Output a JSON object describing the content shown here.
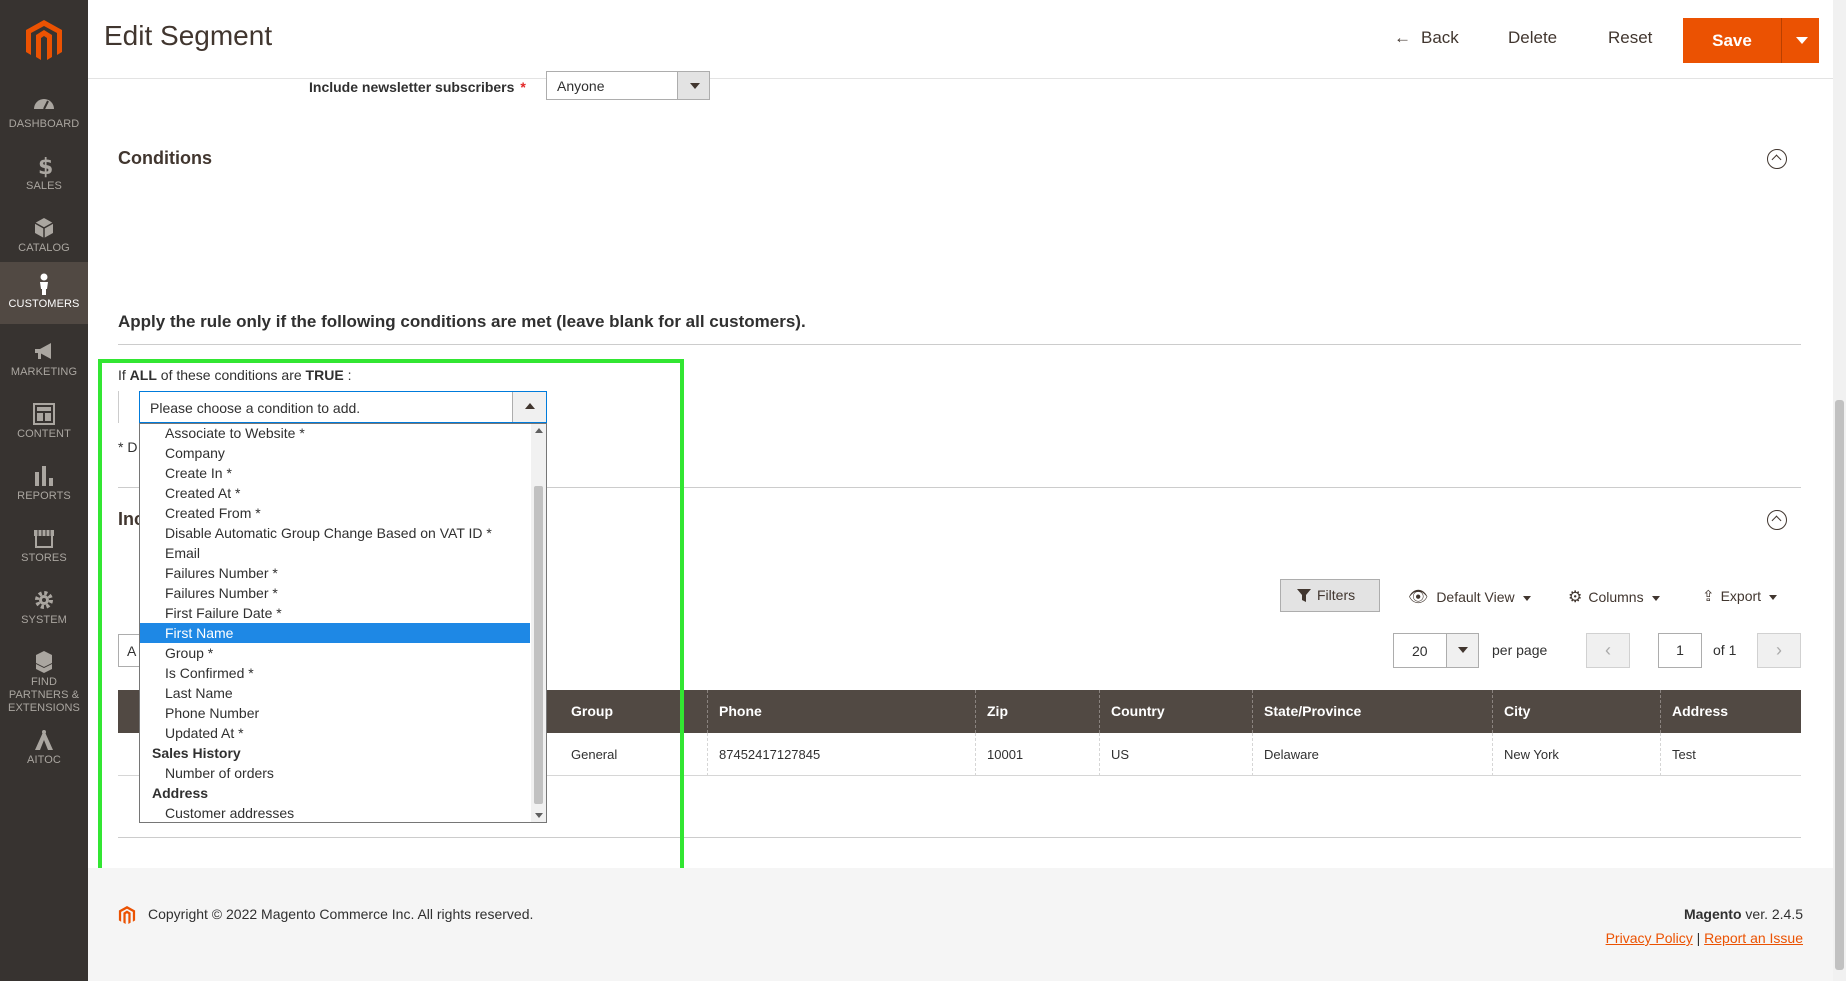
{
  "sidebar": {
    "items": [
      {
        "label": "DASHBOARD"
      },
      {
        "label": "SALES"
      },
      {
        "label": "CATALOG"
      },
      {
        "label": "CUSTOMERS"
      },
      {
        "label": "MARKETING"
      },
      {
        "label": "CONTENT"
      },
      {
        "label": "REPORTS"
      },
      {
        "label": "STORES"
      },
      {
        "label": "SYSTEM"
      },
      {
        "label": "FIND PARTNERS & EXTENSIONS"
      },
      {
        "label": "AITOC"
      }
    ],
    "active": "CUSTOMERS"
  },
  "header": {
    "title": "Edit Segment",
    "back_label": "Back",
    "delete_label": "Delete",
    "reset_label": "Reset",
    "save_label": "Save"
  },
  "form": {
    "newsletter_label": "Include newsletter subscribers",
    "newsletter_value": "Anyone",
    "required_mark": "*"
  },
  "conditions": {
    "section_title": "Conditions",
    "rule_heading": "Apply the rule only if the following conditions are met (leave blank for all customers).",
    "if_text": "If",
    "all_text": "ALL",
    "of_these_text": "of these conditions are",
    "true_text": "TRUE",
    "colon": ":",
    "select_placeholder": "Please choose a condition to add.",
    "note_fragment": "* D",
    "options": [
      {
        "label": "Associate to Website *",
        "type": "item"
      },
      {
        "label": "Company",
        "type": "item"
      },
      {
        "label": "Create In *",
        "type": "item"
      },
      {
        "label": "Created At *",
        "type": "item"
      },
      {
        "label": "Created From *",
        "type": "item"
      },
      {
        "label": "Disable Automatic Group Change Based on VAT ID *",
        "type": "item"
      },
      {
        "label": "Email",
        "type": "item"
      },
      {
        "label": "Failures Number *",
        "type": "item"
      },
      {
        "label": "Failures Number *",
        "type": "item"
      },
      {
        "label": "First Failure Date *",
        "type": "item"
      },
      {
        "label": "First Name",
        "type": "item",
        "selected": true
      },
      {
        "label": "Group *",
        "type": "item"
      },
      {
        "label": "Is Confirmed *",
        "type": "item"
      },
      {
        "label": "Last Name",
        "type": "item"
      },
      {
        "label": "Phone Number",
        "type": "item"
      },
      {
        "label": "Updated At *",
        "type": "item"
      },
      {
        "label": "Sales History",
        "type": "group"
      },
      {
        "label": "Number of orders",
        "type": "item"
      },
      {
        "label": "Address",
        "type": "group"
      },
      {
        "label": "Customer addresses",
        "type": "item"
      }
    ]
  },
  "customers_section": {
    "title_fragment": "Inc"
  },
  "grid": {
    "filters_label": "Filters",
    "default_view_label": "Default View",
    "columns_label": "Columns",
    "export_label": "Export",
    "per_page_value": "20",
    "per_page_label": "per page",
    "page_value": "1",
    "of_label": "of 1",
    "prev_glyph": "‹",
    "next_glyph": "›",
    "action_fragment": "A",
    "columns": [
      "Group",
      "Phone",
      "Zip",
      "Country",
      "State/Province",
      "City",
      "Address"
    ],
    "rows": [
      [
        "General",
        "87452417127845",
        "10001",
        "US",
        "Delaware",
        "New York",
        "Test"
      ]
    ]
  },
  "footer": {
    "copyright": "Copyright © 2022 Magento Commerce Inc. All rights reserved.",
    "brand": "Magento",
    "version": " ver. 2.4.5",
    "privacy_label": "Privacy Policy",
    "separator": " | ",
    "report_label": "Report an Issue"
  },
  "colors": {
    "accent": "#eb5202",
    "sidebar_bg": "#373330",
    "grid_header_bg": "#514943",
    "highlight": "#32e632",
    "selected_option": "#1e88e5"
  }
}
